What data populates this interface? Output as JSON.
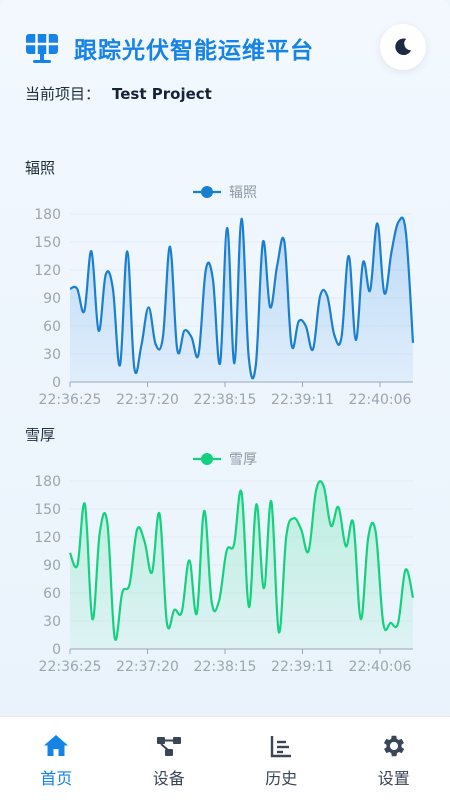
{
  "app": {
    "title": "跟踪光伏智能运维平台",
    "logo_icon": "solar-panel-icon",
    "theme_toggle_icon": "moon-icon"
  },
  "project": {
    "label": "当前项目：",
    "name": "Test Project"
  },
  "sections": {
    "irradiance_title": "辐照",
    "snow_title": "雪厚"
  },
  "colors": {
    "accent": "#1683e6",
    "irradiance_line": "#1a7fd0",
    "snow_line": "#14d17f",
    "axis": "#9aa6b2"
  },
  "chart_data": [
    {
      "type": "area",
      "legend": "辐照",
      "x_tick_labels": [
        "22:36:25",
        "22:37:20",
        "22:38:15",
        "22:39:11",
        "22:40:06"
      ],
      "ylim": [
        0,
        180
      ],
      "y_ticks": [
        0,
        30,
        60,
        90,
        120,
        150,
        180
      ],
      "series": [
        {
          "name": "辐照",
          "values": [
            100,
            100,
            76,
            140,
            55,
            115,
            100,
            18,
            140,
            15,
            40,
            80,
            40,
            48,
            145,
            35,
            55,
            48,
            30,
            120,
            110,
            20,
            165,
            20,
            175,
            28,
            18,
            150,
            80,
            125,
            150,
            40,
            65,
            60,
            35,
            92,
            92,
            50,
            48,
            135,
            45,
            128,
            98,
            170,
            95,
            140,
            172,
            160,
            42
          ]
        }
      ]
    },
    {
      "type": "area",
      "legend": "雪厚",
      "x_tick_labels": [
        "22:36:25",
        "22:37:20",
        "22:38:15",
        "22:39:11",
        "22:40:06"
      ],
      "ylim": [
        0,
        180
      ],
      "y_ticks": [
        0,
        30,
        60,
        90,
        120,
        150,
        180
      ],
      "series": [
        {
          "name": "雪厚",
          "values": [
            103,
            90,
            155,
            32,
            125,
            135,
            12,
            60,
            70,
            128,
            115,
            82,
            145,
            28,
            42,
            40,
            95,
            38,
            148,
            50,
            52,
            105,
            112,
            168,
            45,
            155,
            65,
            158,
            18,
            120,
            140,
            128,
            105,
            170,
            175,
            132,
            152,
            110,
            135,
            32,
            120,
            125,
            28,
            28,
            28,
            85,
            55
          ]
        }
      ]
    }
  ],
  "tabbar": [
    {
      "label": "首页",
      "icon": "home-icon",
      "active": true
    },
    {
      "label": "设备",
      "icon": "device-network-icon",
      "active": false
    },
    {
      "label": "历史",
      "icon": "history-chart-icon",
      "active": false
    },
    {
      "label": "设置",
      "icon": "gear-icon",
      "active": false
    }
  ]
}
